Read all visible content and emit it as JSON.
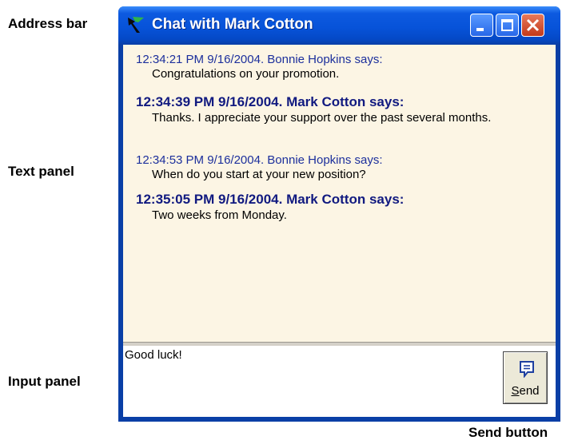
{
  "callouts": {
    "address_bar": "Address bar",
    "text_panel": "Text panel",
    "input_panel": "Input panel",
    "send_button": "Send button"
  },
  "window": {
    "title": "Chat with Mark Cotton",
    "icon": "app-logo-icon",
    "controls": [
      "minimize-icon",
      "maximize-icon",
      "close-icon"
    ]
  },
  "messages": [
    {
      "header": "12:34:21 PM 9/16/2004. Bonnie Hopkins says:",
      "body": "Congratulations on your promotion.",
      "bold": false
    },
    {
      "header": "12:34:39 PM 9/16/2004. Mark Cotton says:",
      "body": "Thanks. I appreciate your support over the past several months.",
      "bold": true
    },
    {
      "header": "12:34:53 PM 9/16/2004. Bonnie Hopkins says:",
      "body": "When do you start at your new position?",
      "bold": false
    },
    {
      "header": "12:35:05 PM 9/16/2004. Mark Cotton says:",
      "body": "Two weeks from Monday.",
      "bold": true
    }
  ],
  "input": {
    "value": "Good luck!"
  },
  "send_button": {
    "label_underlined": "S",
    "label_rest": "end",
    "icon": "message-icon"
  },
  "colors": {
    "titlebar": "#0753d9",
    "text_panel_bg": "#fcf5e4",
    "header_color": "#1c2f9c",
    "close_button": "#c2391b"
  }
}
